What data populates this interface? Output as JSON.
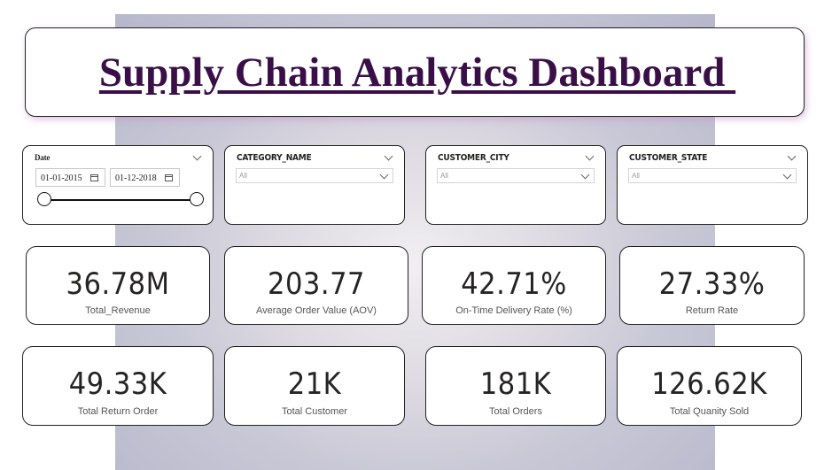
{
  "title": "Supply Chain Analytics Dashboard ",
  "date_slicer": {
    "title": "Date",
    "start": "01-01-2015",
    "end": "01-12-2018"
  },
  "slicers": [
    {
      "title": "CATEGORY_NAME",
      "value": "All"
    },
    {
      "title": "CUSTOMER_CITY",
      "value": "All"
    },
    {
      "title": "CUSTOMER_STATE",
      "value": "All"
    }
  ],
  "kpis": [
    {
      "value": "36.78M",
      "label": "Total_Revenue"
    },
    {
      "value": "203.77",
      "label": "Average Order Value (AOV)"
    },
    {
      "value": "42.71%",
      "label": "On-Time Delivery Rate (%)"
    },
    {
      "value": "27.33%",
      "label": "Return Rate"
    },
    {
      "value": "49.33K",
      "label": "Total Return Order"
    },
    {
      "value": "21K",
      "label": "Total Customer"
    },
    {
      "value": "181K",
      "label": "Total Orders"
    },
    {
      "value": "126.62K",
      "label": "Total Quanity Sold"
    }
  ],
  "colors": {
    "title": "#3a0f48",
    "value": "#252423"
  },
  "icons": {
    "calendar": "calendar-icon",
    "chevron": "chevron-down-icon"
  }
}
